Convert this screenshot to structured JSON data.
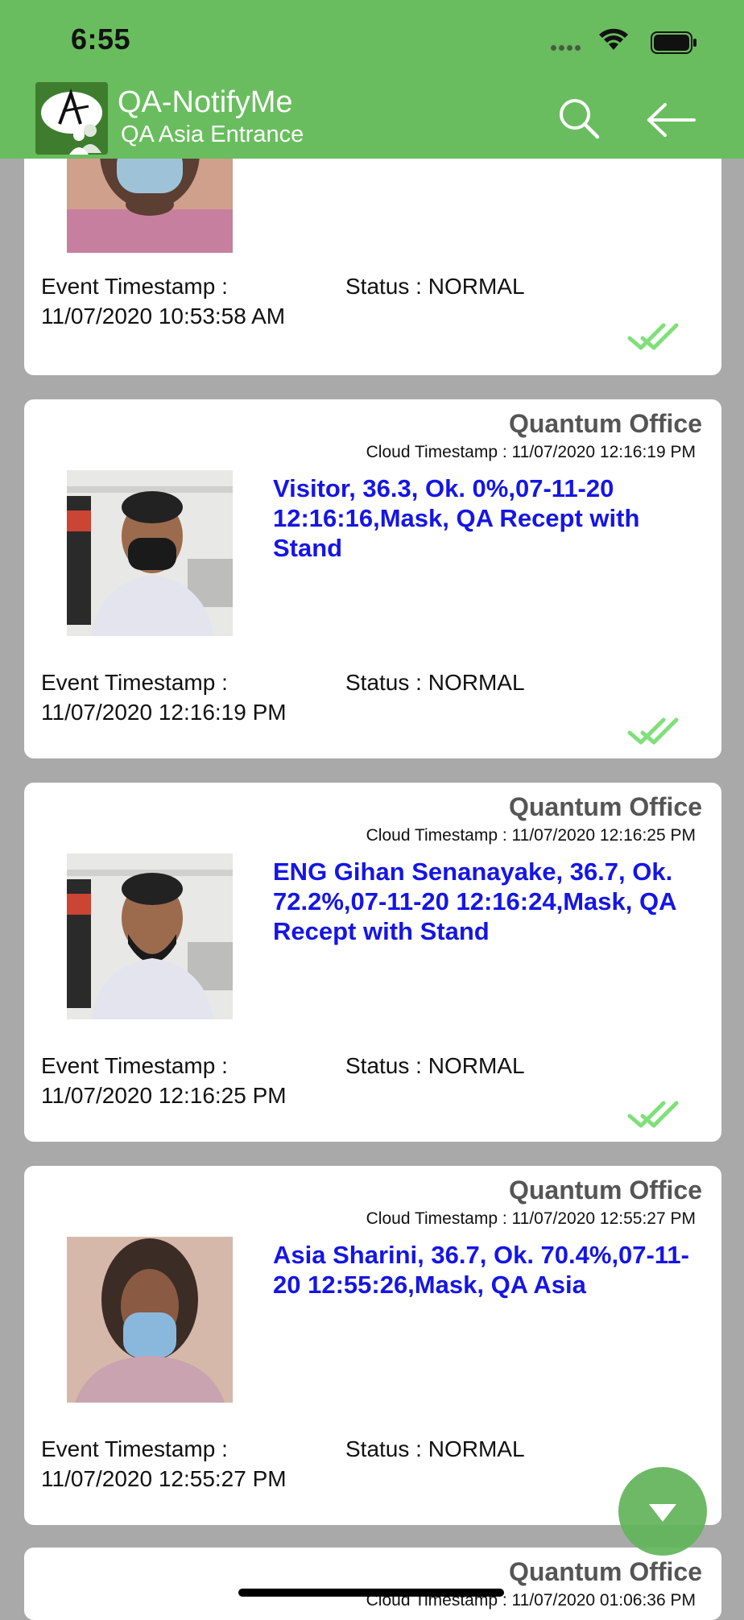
{
  "status_bar": {
    "time": "6:55"
  },
  "header": {
    "title": "QA-NotifyMe",
    "subtitle": "QA Asia Entrance",
    "theme_color": "#69bd5e"
  },
  "labels": {
    "event_timestamp": "Event Timestamp :",
    "check_icon": "double-check-icon"
  },
  "partial_top_card": {
    "event_timestamp": "11/07/2020 10:53:58 AM",
    "status": "Status : NORMAL"
  },
  "cards": [
    {
      "org": "Quantum Office",
      "cloud_timestamp": "Cloud Timestamp : 11/07/2020 12:16:19 PM",
      "message": "Visitor, 36.3, Ok. 0%,07-11-20 12:16:16,Mask, QA Recept with Stand",
      "event_timestamp": "11/07/2020 12:16:19 PM",
      "status": "Status : NORMAL"
    },
    {
      "org": "Quantum Office",
      "cloud_timestamp": "Cloud Timestamp : 11/07/2020 12:16:25 PM",
      "message": "ENG Gihan Senanayake, 36.7, Ok. 72.2%,07-11-20 12:16:24,Mask, QA Recept with Stand",
      "event_timestamp": "11/07/2020 12:16:25 PM",
      "status": "Status : NORMAL"
    },
    {
      "org": "Quantum Office",
      "cloud_timestamp": "Cloud Timestamp : 11/07/2020 12:55:27 PM",
      "message": "Asia Sharini, 36.7, Ok. 70.4%,07-11-20 12:55:26,Mask, QA Asia",
      "event_timestamp": "11/07/2020 12:55:27 PM",
      "status": "Status : NORMAL"
    }
  ],
  "partial_bottom_card": {
    "org": "Quantum Office",
    "cloud_timestamp": "Cloud Timestamp : 11/07/2020 01:06:36 PM"
  },
  "colors": {
    "message": "#1515e6",
    "check": "#7fe07a",
    "background": "#a9a9a9"
  }
}
